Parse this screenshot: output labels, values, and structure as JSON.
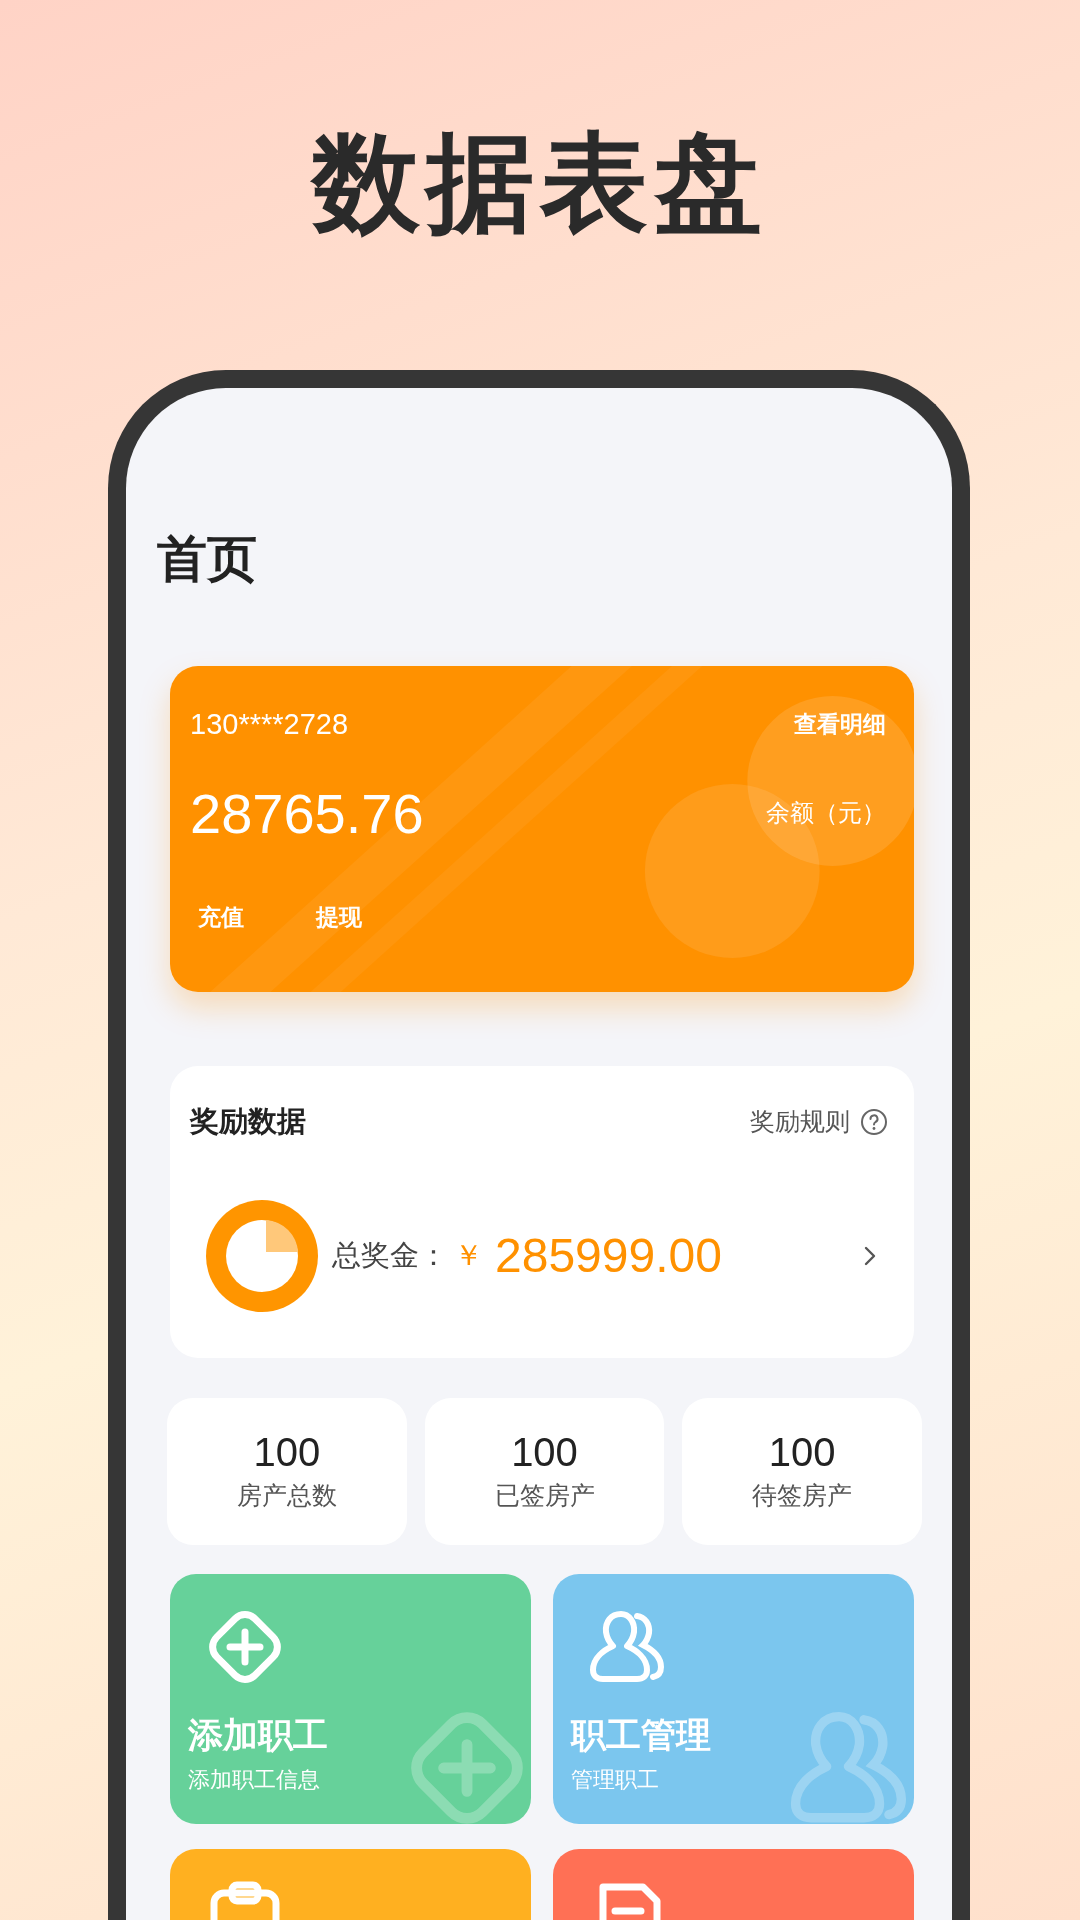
{
  "page_title": "数据表盘",
  "screen_title": "首页",
  "balance_card": {
    "phone": "130****2728",
    "details_link": "查看明细",
    "amount": "28765.76",
    "amount_label": "余额（元）",
    "actions": [
      "充值",
      "提现"
    ]
  },
  "reward": {
    "title": "奖励数据",
    "rules_link": "奖励规则",
    "total_label": "总奖金：",
    "currency": "￥",
    "total": "285999.00"
  },
  "stats": [
    {
      "value": "100",
      "label": "房产总数"
    },
    {
      "value": "100",
      "label": "已签房产"
    },
    {
      "value": "100",
      "label": "待签房产"
    }
  ],
  "tiles": [
    {
      "kind": "add",
      "title": "添加职工",
      "subtitle": "添加职工信息",
      "color": "#66d19a"
    },
    {
      "kind": "people",
      "title": "职工管理",
      "subtitle": "管理职工",
      "color": "#7bc6ee"
    },
    {
      "kind": "clipboard",
      "color": "#ffb020"
    },
    {
      "kind": "document",
      "color": "#ff7055"
    }
  ]
}
